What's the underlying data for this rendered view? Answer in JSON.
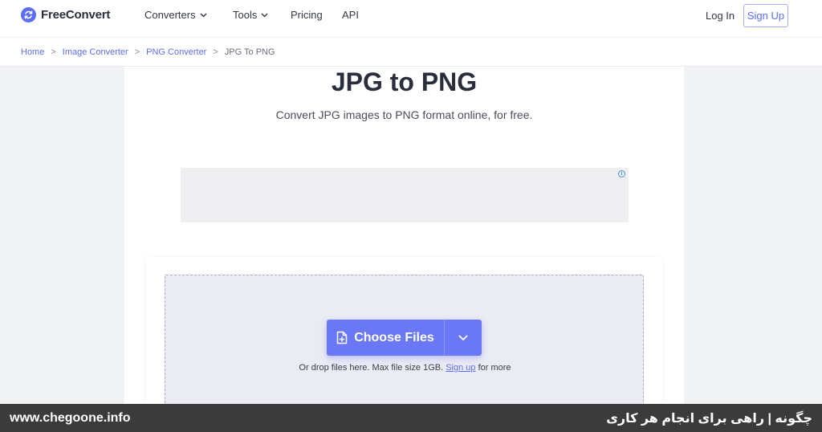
{
  "brand": {
    "name": "FreeConvert",
    "color": "#5c6ef8"
  },
  "nav": {
    "items": [
      {
        "label": "Converters",
        "has_dropdown": true
      },
      {
        "label": "Tools",
        "has_dropdown": true
      },
      {
        "label": "Pricing",
        "has_dropdown": false
      },
      {
        "label": "API",
        "has_dropdown": false
      }
    ],
    "login": "Log In",
    "signup": "Sign Up"
  },
  "breadcrumb": {
    "items": [
      "Home",
      "Image Converter",
      "PNG Converter",
      "JPG To PNG"
    ],
    "separator": ">"
  },
  "main": {
    "title": "JPG to PNG",
    "subtitle": "Convert JPG images to PNG format online, for free.",
    "ad_info_icon": "i"
  },
  "upload": {
    "button_label": "Choose Files",
    "button_icon": "file-plus-icon",
    "dropdown_icon": "chevron-down-icon",
    "hint_prefix": "Or drop files here. Max file size 1GB.",
    "hint_link": "Sign up",
    "hint_suffix": "for more"
  },
  "footer": {
    "site": "www.chegoone.info",
    "tagline": "چگونه | راهی برای انجام هر کاری"
  },
  "colors": {
    "accent": "#5c6ef8",
    "button": "#6a78f5",
    "dropzone": "#ebebf4",
    "footer": "#3b3b3b"
  }
}
